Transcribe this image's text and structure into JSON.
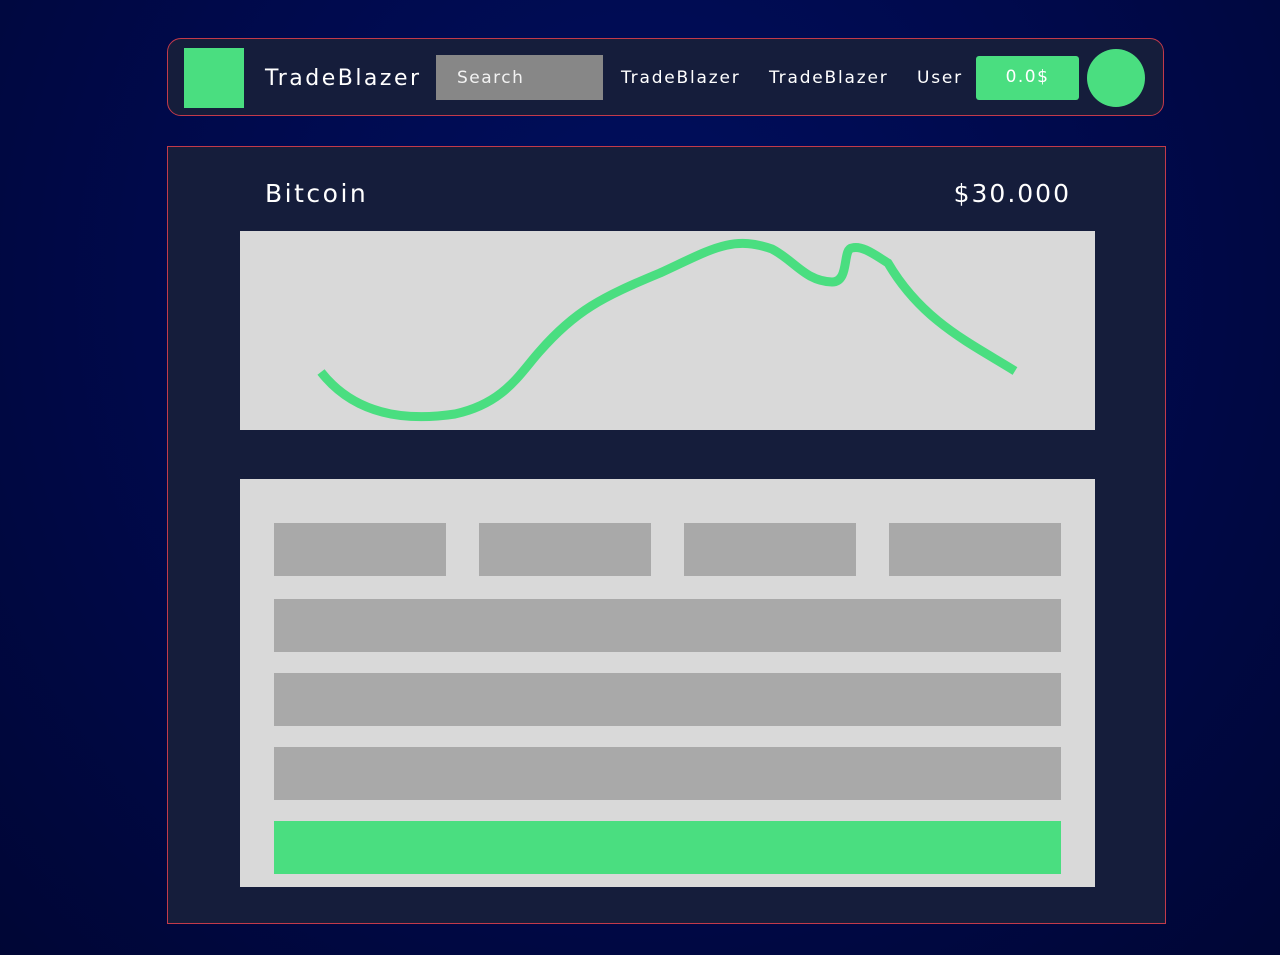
{
  "header": {
    "brand": "TradeBlazer",
    "search": {
      "placeholder": "Search",
      "value": ""
    },
    "nav_links": [
      "TradeBlazer",
      "TradeBlazer",
      "User"
    ],
    "balance": "0.0$"
  },
  "coin": {
    "name": "Bitcoin",
    "price": "$30.000"
  },
  "colors": {
    "accent": "#4ade80",
    "panel": "#151d3b",
    "border": "#c23a4a",
    "placeholder_block": "#a9a9a9",
    "card": "#d9d9d9"
  }
}
